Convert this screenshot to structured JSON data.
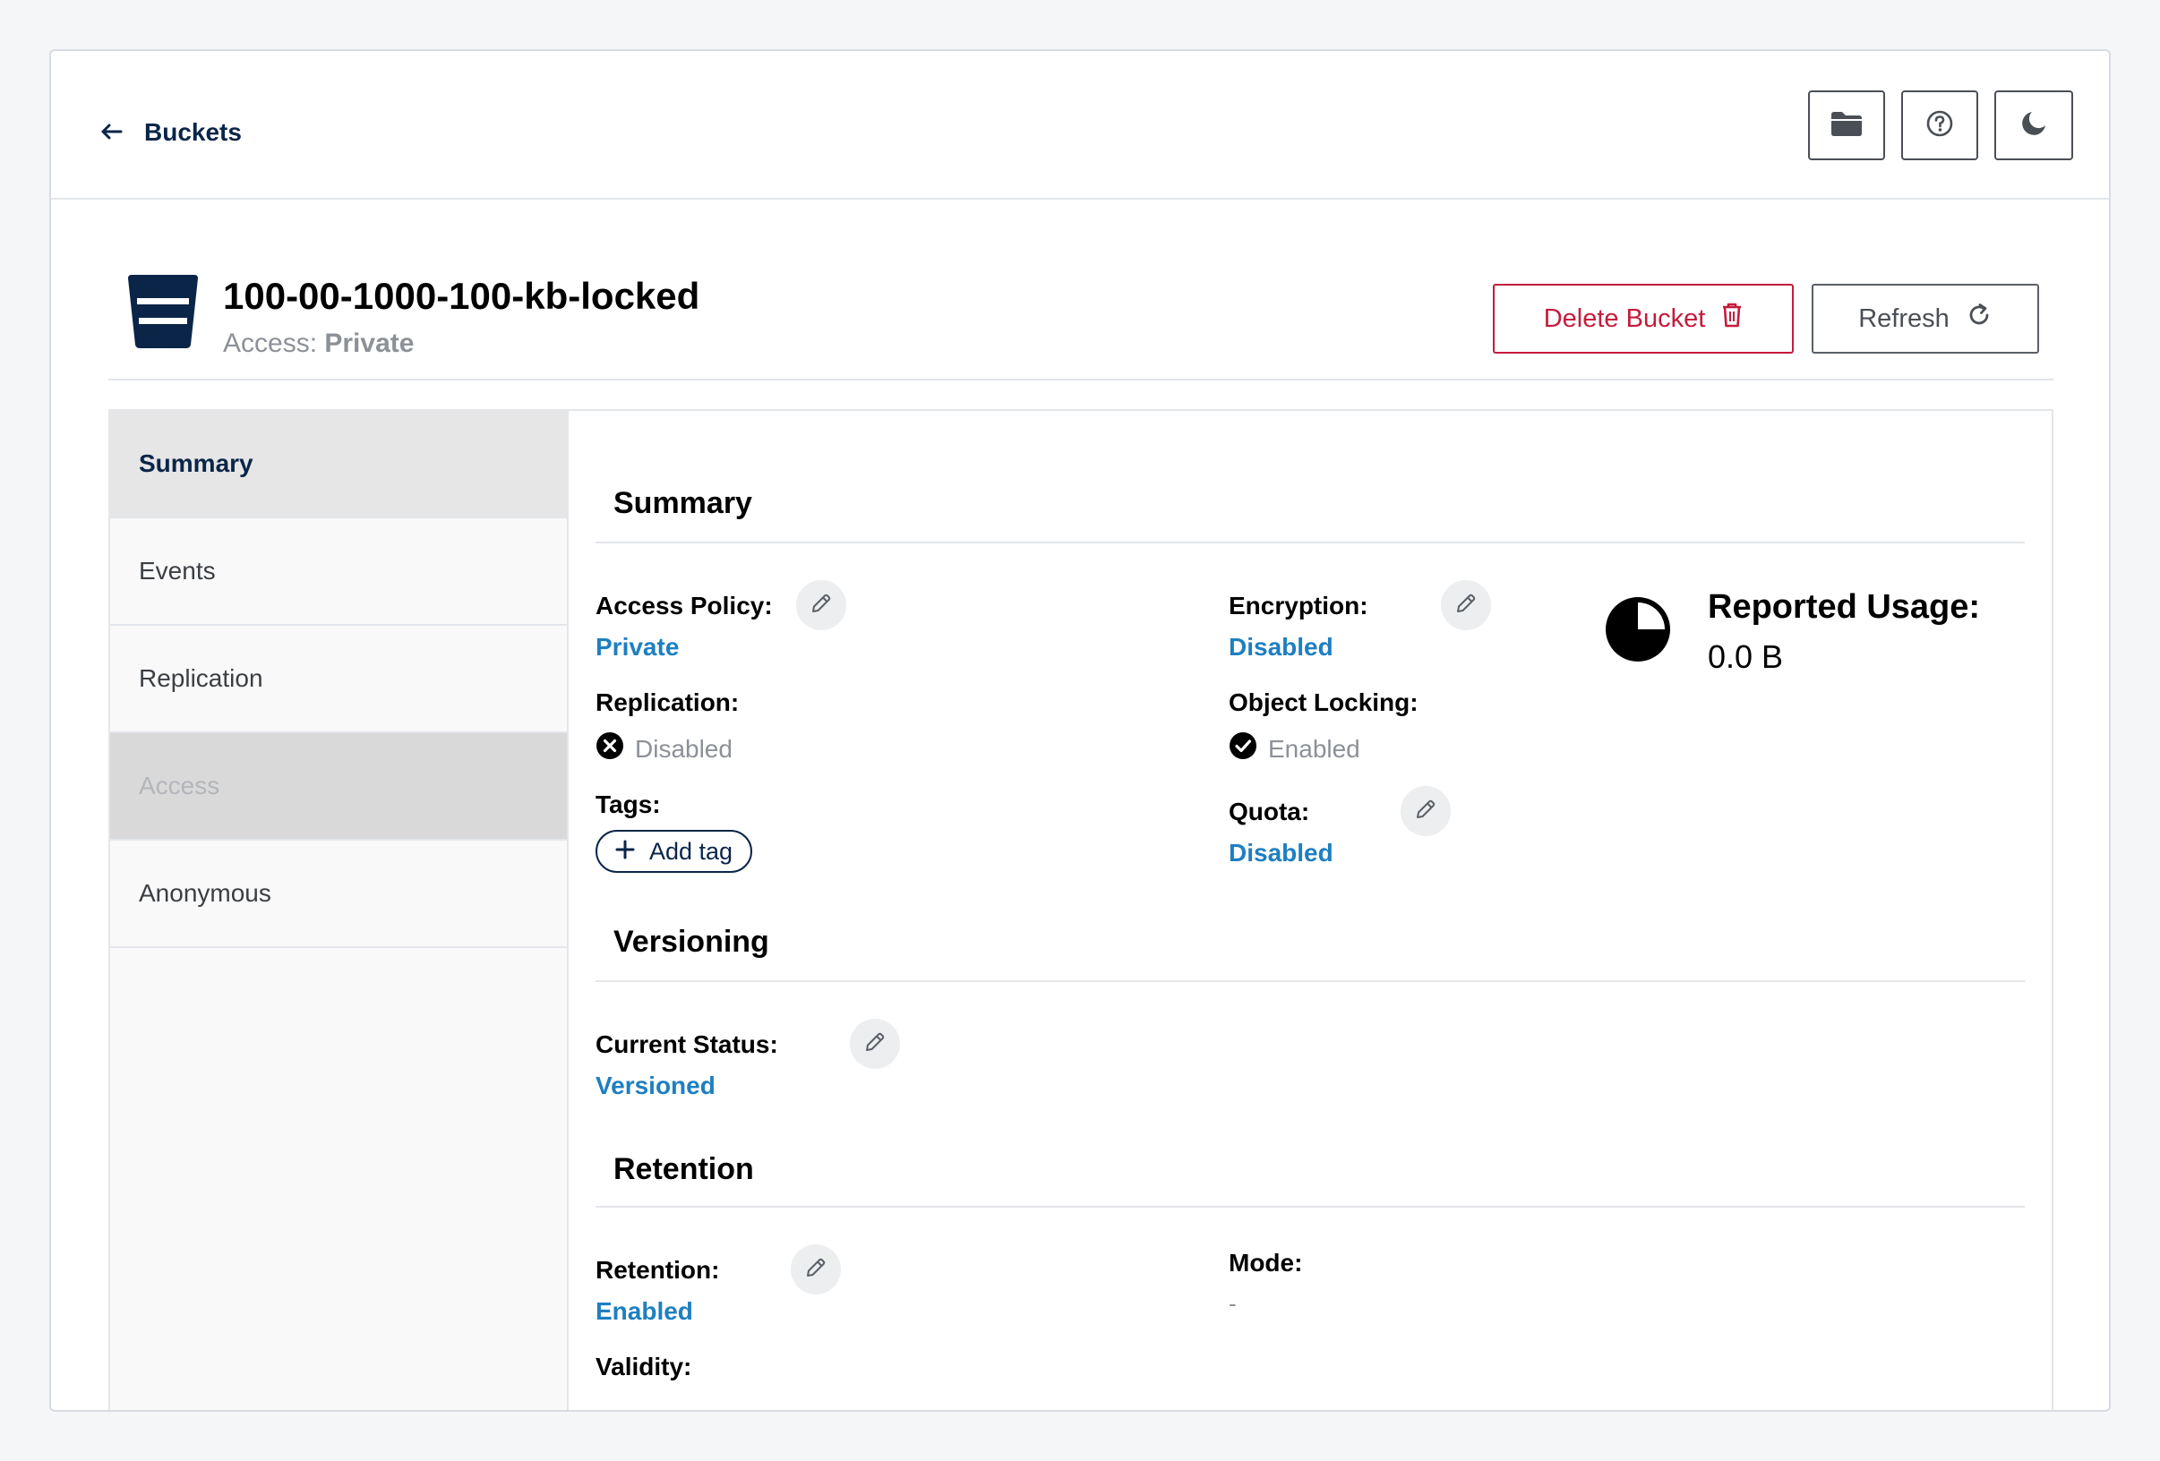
{
  "topbar": {
    "back_label": "Buckets",
    "icons": [
      "folder-icon",
      "help-icon",
      "dark-mode-icon"
    ]
  },
  "header": {
    "bucket_name": "100-00-1000-100-kb-locked",
    "access_prefix": "Access:",
    "access_value": "Private",
    "delete_label": "Delete Bucket",
    "refresh_label": "Refresh"
  },
  "sidebar": {
    "items": [
      {
        "label": "Summary",
        "state": "active"
      },
      {
        "label": "Events",
        "state": "normal"
      },
      {
        "label": "Replication",
        "state": "normal"
      },
      {
        "label": "Access",
        "state": "disabled"
      },
      {
        "label": "Anonymous",
        "state": "normal"
      }
    ]
  },
  "summary": {
    "title": "Summary",
    "access_policy_label": "Access Policy:",
    "access_policy_value": "Private",
    "encryption_label": "Encryption:",
    "encryption_value": "Disabled",
    "replication_label": "Replication:",
    "replication_value": "Disabled",
    "object_locking_label": "Object Locking:",
    "object_locking_value": "Enabled",
    "tags_label": "Tags:",
    "add_tag_label": "Add tag",
    "quota_label": "Quota:",
    "quota_value": "Disabled",
    "usage_label": "Reported Usage:",
    "usage_value": "0.0 B"
  },
  "versioning": {
    "title": "Versioning",
    "status_label": "Current Status:",
    "status_value": "Versioned"
  },
  "retention": {
    "title": "Retention",
    "retention_label": "Retention:",
    "retention_value": "Enabled",
    "mode_label": "Mode:",
    "mode_value": "-",
    "validity_label": "Validity:"
  },
  "colors": {
    "link": "#1e7fc1",
    "navy": "#0b2549",
    "danger": "#c51b3c"
  }
}
